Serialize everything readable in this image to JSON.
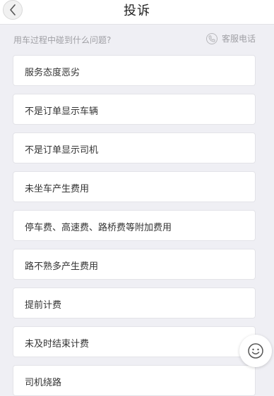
{
  "header": {
    "title": "投诉",
    "back_icon": "chevron-left-icon"
  },
  "subheader": {
    "question": "用车过程中碰到什么问题?",
    "hotline_label": "客服电话",
    "hotline_icon": "phone-icon"
  },
  "options": [
    {
      "label": "服务态度恶劣"
    },
    {
      "label": "不是订单显示车辆"
    },
    {
      "label": "不是订单显示司机"
    },
    {
      "label": "未坐车产生费用"
    },
    {
      "label": "停车费、高速费、路桥费等附加费用"
    },
    {
      "label": "路不熟多产生费用"
    },
    {
      "label": "提前计费"
    },
    {
      "label": "未及时结束计费"
    },
    {
      "label": "司机绕路"
    }
  ],
  "floating": {
    "icon": "smiley-icon"
  },
  "colors": {
    "background": "#efeff4",
    "card": "#ffffff",
    "muted_text": "#a0a0a5"
  }
}
